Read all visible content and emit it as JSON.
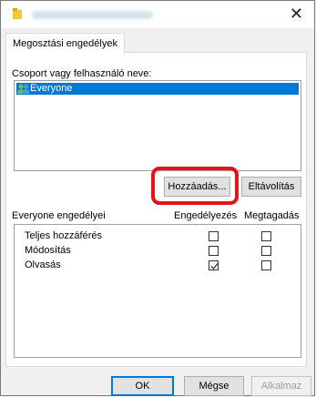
{
  "window": {
    "close_glyph": "✕"
  },
  "tab": {
    "label": "Megosztási engedélyek"
  },
  "group": {
    "label": "Csoport vagy felhasználó neve:",
    "items": [
      {
        "name": "Everyone",
        "icon": "users-icon",
        "selected": true
      }
    ]
  },
  "buttons": {
    "add": "Hozzáadás...",
    "remove": "Eltávolítás"
  },
  "permissions": {
    "title": "Everyone engedélyei",
    "col_allow": "Engedélyezés",
    "col_deny": "Megtagadás",
    "rows": [
      {
        "label": "Teljes hozzáférés",
        "allow": false,
        "deny": false
      },
      {
        "label": "Módosítás",
        "allow": false,
        "deny": false
      },
      {
        "label": "Olvasás",
        "allow": true,
        "deny": false
      }
    ]
  },
  "footer": {
    "ok": "OK",
    "cancel": "Mégse",
    "apply": "Alkalmaz"
  },
  "colors": {
    "selection": "#0078d7",
    "highlight": "#e8111a",
    "folder": "#f5c542"
  }
}
